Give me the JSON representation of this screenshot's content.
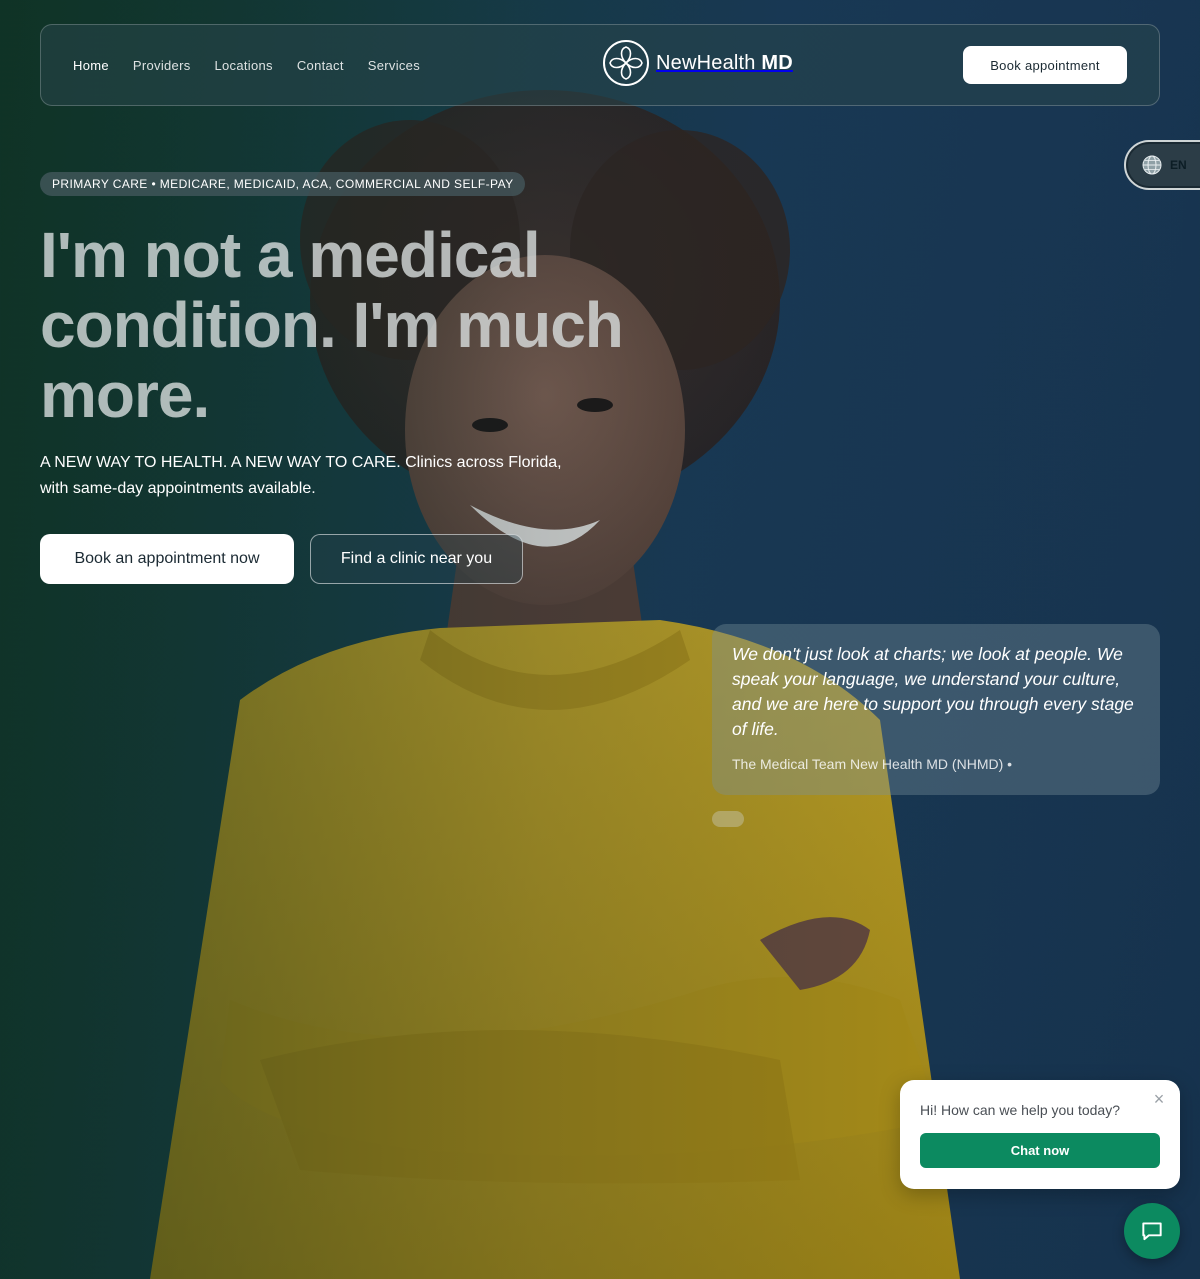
{
  "nav": {
    "links": [
      {
        "label": "Home",
        "active": true
      },
      {
        "label": "Providers",
        "active": false
      },
      {
        "label": "Locations",
        "active": false
      },
      {
        "label": "Contact",
        "active": false
      },
      {
        "label": "Services",
        "active": false
      }
    ],
    "brand": {
      "name_light": "NewHealth",
      "name_bold": "MD"
    },
    "cta": "Book appointment"
  },
  "language": {
    "code": "EN",
    "icon": "globe-icon"
  },
  "hero": {
    "pill": "PRIMARY CARE • MEDICARE, MEDICAID, ACA, COMMERCIAL AND SELF-PAY",
    "headline": "I'm not a medical condition. I'm much more.",
    "subtext": "A NEW WAY TO HEALTH. A NEW WAY TO CARE. Clinics across Florida, with same-day appointments available.",
    "primary_button": "Book an appointment now",
    "secondary_button": "Find a clinic near you"
  },
  "quote": {
    "text": "We don't just look at charts; we look at people. We speak your language, we understand your culture, and we are here to support you through every stage of life.",
    "author": "The Medical Team New Health MD (NHMD) •"
  },
  "chat": {
    "greeting": "Hi! How can we help you today?",
    "button": "Chat now",
    "close_icon": "close-icon",
    "fab_icon": "chat-bubble-icon"
  },
  "colors": {
    "accent_green": "#0c8a60",
    "sweater": "#c9a722",
    "background_dark": "#173f45"
  }
}
